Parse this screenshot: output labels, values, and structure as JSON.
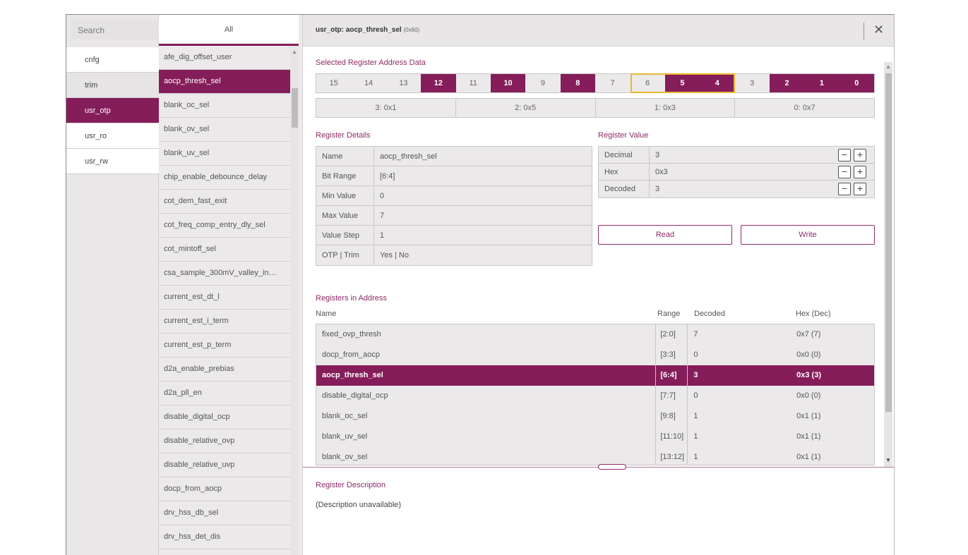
{
  "search": {
    "placeholder": "Search"
  },
  "all_tab": "All",
  "categories": [
    {
      "label": "cnfg"
    },
    {
      "label": "trim"
    },
    {
      "label": "usr_otp"
    },
    {
      "label": "usr_ro"
    },
    {
      "label": "usr_rw"
    }
  ],
  "registers": [
    "afe_dig_offset_user",
    "aocp_thresh_sel",
    "blank_oc_sel",
    "blank_ov_sel",
    "blank_uv_sel",
    "chip_enable_debounce_delay",
    "cot_dem_fast_exit",
    "cot_freq_comp_entry_dly_sel",
    "cot_mintoff_sel",
    "csa_sample_300mV_valley_in…",
    "current_est_dt_l",
    "current_est_i_term",
    "current_est_p_term",
    "d2a_enable_prebias",
    "d2a_pll_en",
    "disable_digital_ocp",
    "disable_relative_ovp",
    "disable_relative_uvp",
    "docp_from_aocp",
    "drv_hss_db_sel",
    "drv_hss_det_dis"
  ],
  "title": {
    "main": "usr_otp: aocp_thresh_sel",
    "addr": "(0x60)",
    "close": "✕"
  },
  "address_section": {
    "label": "Selected Register Address Data",
    "bits": [
      "15",
      "14",
      "13",
      "12",
      "11",
      "10",
      "9",
      "8",
      "7",
      "6",
      "5",
      "4",
      "3",
      "2",
      "1",
      "0"
    ],
    "bits_on": [
      false,
      false,
      false,
      true,
      false,
      true,
      false,
      true,
      false,
      false,
      true,
      true,
      false,
      true,
      true,
      true
    ],
    "nibbles": [
      "3: 0x1",
      "2: 0x5",
      "1: 0x3",
      "0: 0x7"
    ]
  },
  "details": {
    "label": "Register Details",
    "rows": [
      {
        "key": "Name",
        "value": "aocp_thresh_sel"
      },
      {
        "key": "Bit Range",
        "value": "[6:4]"
      },
      {
        "key": "Min Value",
        "value": "0"
      },
      {
        "key": "Max Value",
        "value": "7"
      },
      {
        "key": "Value Step",
        "value": "1"
      },
      {
        "key": "OTP | Trim",
        "value": "Yes | No"
      }
    ]
  },
  "value_panel": {
    "label": "Register Value",
    "rows": [
      {
        "key": "Decimal",
        "value": "3"
      },
      {
        "key": "Hex",
        "value": "0x3"
      },
      {
        "key": "Decoded",
        "value": "3"
      }
    ],
    "minus": "−",
    "plus": "+",
    "read_label": "Read",
    "write_label": "Write"
  },
  "registers_in_address": {
    "label": "Registers in Address",
    "headers": {
      "name": "Name",
      "range": "Range",
      "decoded": "Decoded",
      "hex": "Hex (Dec)"
    },
    "rows": [
      {
        "name": "fixed_ovp_thresh",
        "range": "[2:0]",
        "decoded": "7",
        "hex": "0x7 (7)"
      },
      {
        "name": "docp_from_aocp",
        "range": "[3:3]",
        "decoded": "0",
        "hex": "0x0 (0)"
      },
      {
        "name": "aocp_thresh_sel",
        "range": "[6:4]",
        "decoded": "3",
        "hex": "0x3 (3)"
      },
      {
        "name": "disable_digital_ocp",
        "range": "[7:7]",
        "decoded": "0",
        "hex": "0x0 (0)"
      },
      {
        "name": "blank_oc_sel",
        "range": "[9:8]",
        "decoded": "1",
        "hex": "0x1 (1)"
      },
      {
        "name": "blank_uv_sel",
        "range": "[11:10]",
        "decoded": "1",
        "hex": "0x1 (1)"
      },
      {
        "name": "blank_ov_sel",
        "range": "[13:12]",
        "decoded": "1",
        "hex": "0x1 (1)"
      }
    ]
  },
  "description": {
    "label": "Register Description",
    "text": "(Description unavailable)"
  },
  "colors": {
    "accent": "#851d5a",
    "selection": "#e9b72f"
  }
}
